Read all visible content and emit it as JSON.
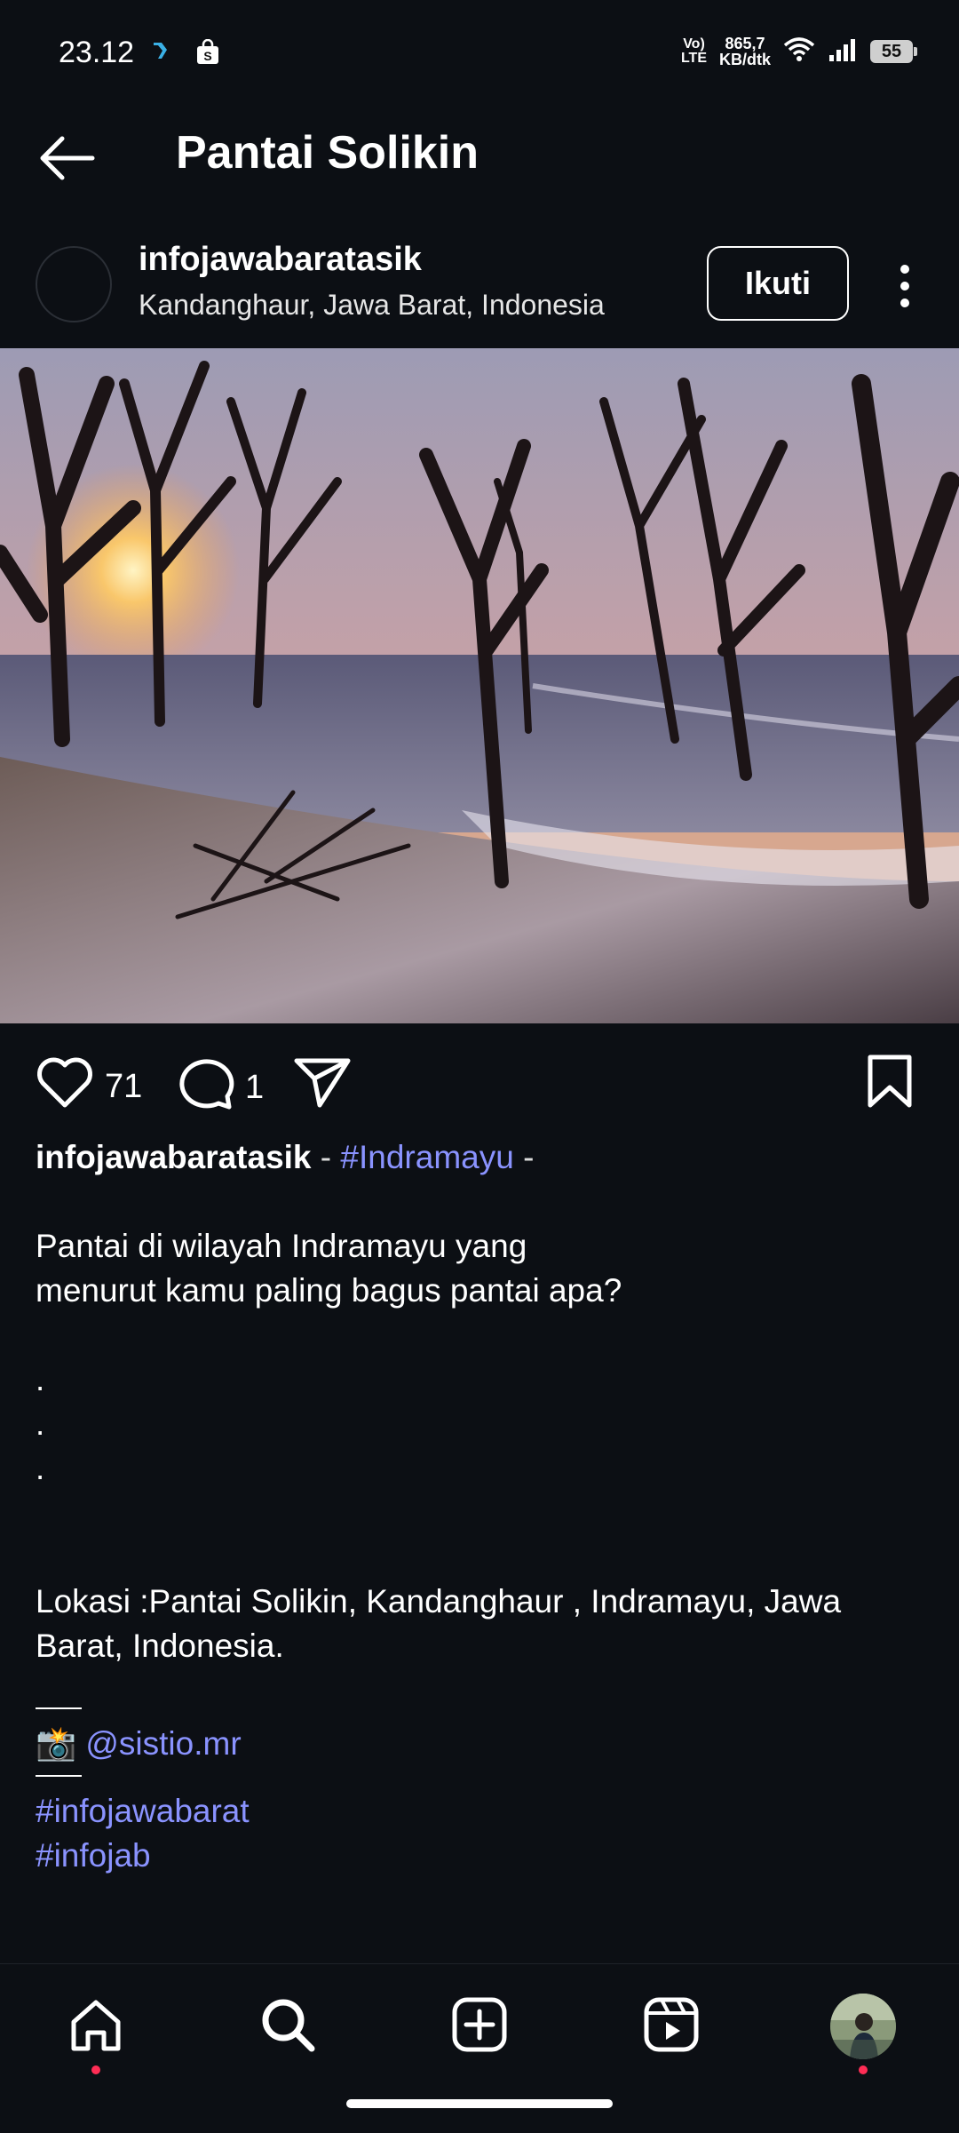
{
  "status_bar": {
    "time": "23.12",
    "volte": "Vo)",
    "lte": "LTE",
    "speed_value": "865,7",
    "speed_unit": "KB/dtk",
    "battery": "55"
  },
  "header": {
    "title": "Pantai Solikin"
  },
  "post": {
    "username": "infojawabaratasik",
    "location": "Kandanghaur, Jawa Barat, Indonesia",
    "follow_label": "Ikuti",
    "likes": "71",
    "comments": "1"
  },
  "caption": {
    "username": "infojawabaratasik",
    "sep1": " - ",
    "hashtag1": "#Indramayu",
    "sep2": " -",
    "line1": "Pantai di wilayah Indramayu yang",
    "line2": "menurut kamu paling bagus pantai apa?",
    "dot1": ".",
    "dot2": ".",
    "dot3": ".",
    "location_line1": "Lokasi :Pantai Solikin, Kandanghaur , Indramayu, Jawa",
    "location_line2": "Barat, Indonesia.",
    "camera_emoji": "📸",
    "credit": "@sistio.mr",
    "hashtag2": "#infojawabarat",
    "hashtag3": "#infojab"
  },
  "bottom_nav": {
    "items": [
      "home",
      "search",
      "create",
      "reels",
      "profile"
    ]
  }
}
